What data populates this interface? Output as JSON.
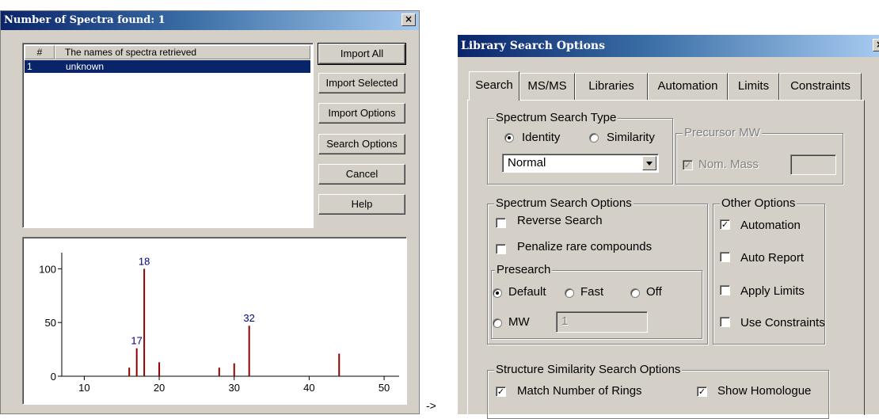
{
  "left_dialog": {
    "title": "Number of Spectra found: 1",
    "close_glyph": "×",
    "list": {
      "columns": [
        "#",
        "The names of spectra retrieved"
      ],
      "rows": [
        {
          "num": "1",
          "name": "unknown"
        }
      ]
    },
    "buttons": {
      "import_all": "Import All",
      "import_selected": "Import Selected",
      "import_options": "Import Options",
      "search_options": "Search Options",
      "cancel": "Cancel",
      "help": "Help"
    }
  },
  "chart_data": {
    "type": "bar",
    "xlim": [
      7,
      52
    ],
    "ylim": [
      0,
      115
    ],
    "x_ticks": [
      10,
      20,
      30,
      40,
      50
    ],
    "y_ticks": [
      0,
      50,
      100
    ],
    "bars": [
      {
        "x": 16,
        "y": 8
      },
      {
        "x": 17,
        "y": 26
      },
      {
        "x": 18,
        "y": 100
      },
      {
        "x": 20,
        "y": 13
      },
      {
        "x": 28,
        "y": 8
      },
      {
        "x": 30,
        "y": 12
      },
      {
        "x": 32,
        "y": 47
      },
      {
        "x": 44,
        "y": 21
      }
    ],
    "peak_labels": [
      {
        "x": 18,
        "y": 100,
        "text": "18"
      },
      {
        "x": 17,
        "y": 26,
        "text": "17"
      },
      {
        "x": 32,
        "y": 47,
        "text": "32"
      }
    ],
    "bar_color": "#8b0000",
    "label_color": "#00007f"
  },
  "arrow_text": "->",
  "right_dialog": {
    "title": "Library Search Options",
    "tabs": [
      "Search",
      "MS/MS",
      "Libraries",
      "Automation",
      "Limits",
      "Constraints"
    ],
    "active_tab": "Search",
    "spectrum_search_type": {
      "legend": "Spectrum Search Type",
      "identity": "Identity",
      "similarity": "Similarity",
      "selected": "Identity",
      "dropdown_value": "Normal"
    },
    "precursor": {
      "legend": "Precursor MW",
      "nom_mass": "Nom. Mass",
      "nom_mass_checked": true
    },
    "spectrum_search_options": {
      "legend": "Spectrum Search Options",
      "reverse_search": "Reverse Search",
      "penalize": "Penalize rare compounds"
    },
    "presearch": {
      "legend": "Presearch",
      "default": "Default",
      "fast": "Fast",
      "off": "Off",
      "mw": "MW",
      "mw_value": "1",
      "selected": "Default"
    },
    "other_options": {
      "legend": "Other Options",
      "automation": "Automation",
      "auto_report": "Auto Report",
      "apply_limits": "Apply Limits",
      "use_constraints": "Use Constraints"
    },
    "structure": {
      "legend": "Structure Similarity Search Options",
      "match_rings": "Match Number of Rings",
      "show_homologues": "Show Homologue"
    }
  }
}
